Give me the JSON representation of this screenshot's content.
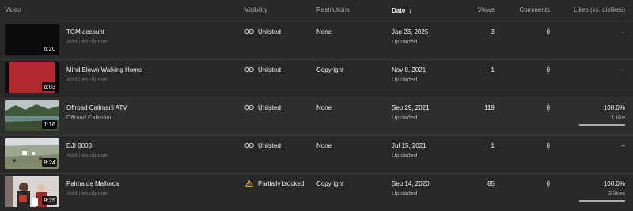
{
  "header": {
    "video": "Video",
    "visibility": "Visibility",
    "restrictions": "Restrictions",
    "date": "Date",
    "date_arrow": "↓",
    "views": "Views",
    "comments": "Comments",
    "likes": "Likes (vs. dislikes)"
  },
  "rows": [
    {
      "title": "TGM account",
      "description": "Add description",
      "duration": "6:20",
      "thumb_icon": "black-video-thumbnail",
      "visibility": "Unlisted",
      "visibility_icon": "link-icon",
      "restrictions": "None",
      "date": "Jan 23, 2025",
      "date_sub": "Uploaded",
      "views": "3",
      "comments": "0",
      "likes": "–"
    },
    {
      "title": "Mind Blown Walking Home",
      "description": "Add description",
      "duration": "6:03",
      "thumb_icon": "red-frame-thumbnail",
      "visibility": "Unlisted",
      "visibility_icon": "link-icon",
      "restrictions": "Copyright",
      "date": "Nov 8, 2021",
      "date_sub": "Uploaded",
      "views": "1",
      "comments": "0",
      "likes": "–"
    },
    {
      "title": "Offroad Calimani ATV",
      "description": "Offroad Calimani",
      "duration": "1:16",
      "thumb_icon": "lake-landscape-thumbnail",
      "visibility": "Unlisted",
      "visibility_icon": "link-icon",
      "restrictions": "None",
      "date": "Sep 29, 2021",
      "date_sub": "Uploaded",
      "views": "119",
      "comments": "0",
      "likes": "100.0%",
      "likes_sub": "1 like",
      "like_ratio": 1.0
    },
    {
      "title": "DJI 0008",
      "description": "Add description",
      "duration": "8:24",
      "thumb_icon": "aerial-field-thumbnail",
      "visibility": "Unlisted",
      "visibility_icon": "link-icon",
      "restrictions": "None",
      "date": "Jul 15, 2021",
      "date_sub": "Uploaded",
      "views": "1",
      "comments": "0",
      "likes": "–"
    },
    {
      "title": "Palma de Mallorca",
      "description": "Add description",
      "duration": "8:25",
      "thumb_icon": "people-thumbnail",
      "visibility": "Partially blocked",
      "visibility_icon": "warning-icon",
      "restrictions": "Copyright",
      "date": "Sep 14, 2020",
      "date_sub": "Uploaded",
      "views": "85",
      "comments": "0",
      "likes": "100.0%",
      "likes_sub": "3 likes",
      "like_ratio": 1.0
    }
  ],
  "colors": {
    "background": "#282828",
    "row_alt": "#2e2e2e",
    "text": "#f1f1f1",
    "muted": "#aaaaaa",
    "warning": "#f2c94c"
  }
}
